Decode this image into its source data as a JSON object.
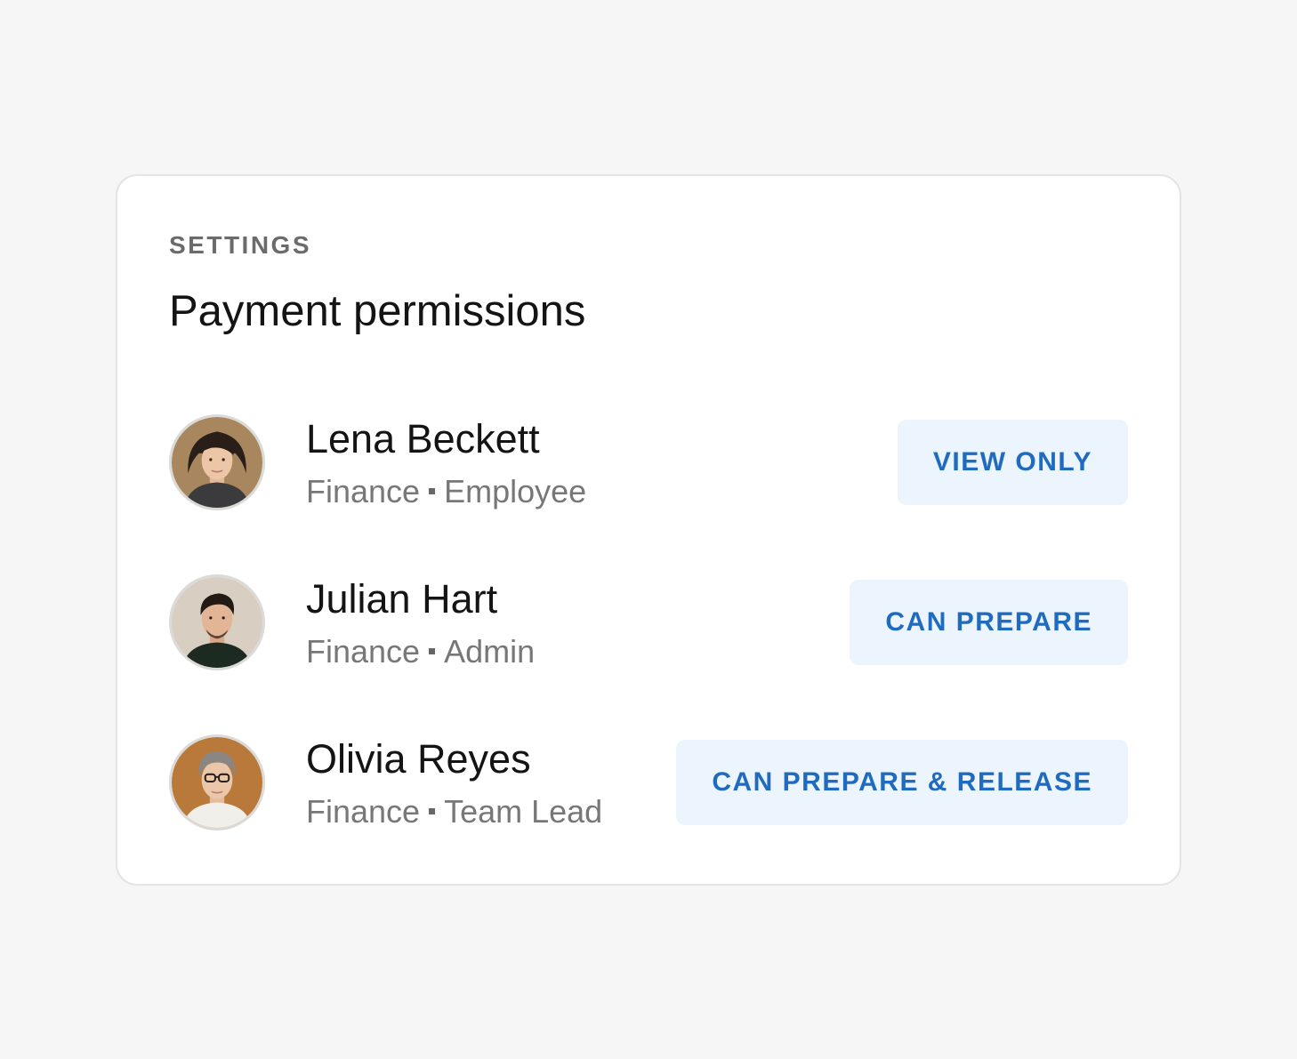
{
  "settings": {
    "eyebrow": "SETTINGS",
    "title": "Payment permissions"
  },
  "people": [
    {
      "name": "Lena Beckett",
      "department": "Finance",
      "role": "Employee",
      "permission": "VIEW ONLY"
    },
    {
      "name": "Julian Hart",
      "department": "Finance",
      "role": "Admin",
      "permission": "CAN PREPARE"
    },
    {
      "name": "Olivia Reyes",
      "department": "Finance",
      "role": "Team Lead",
      "permission": "CAN PREPARE & RELEASE"
    }
  ],
  "colors": {
    "page_background": "#f6f6f6",
    "card_background": "#ffffff",
    "accent_text": "#1f6bbf",
    "accent_background": "#ecf4fd",
    "muted_text": "#777777"
  }
}
